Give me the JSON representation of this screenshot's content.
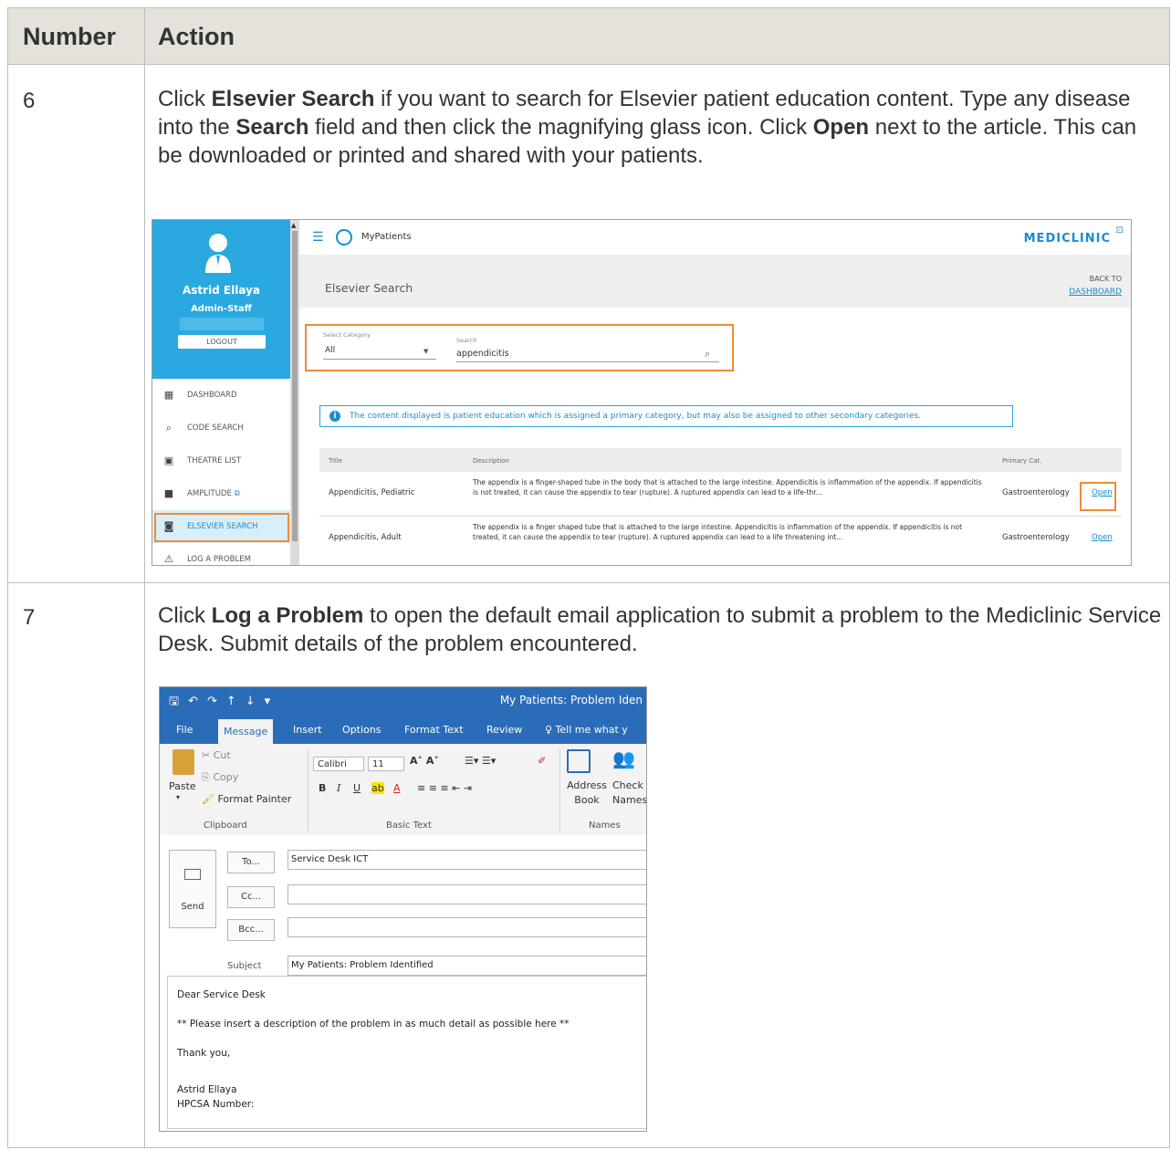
{
  "table": {
    "headers": [
      "Number",
      "Action"
    ],
    "rows": [
      {
        "number": "6",
        "text_parts": [
          "Click ",
          "Elsevier Search",
          " if you want to search for Elsevier patient education content. Type any disease into the ",
          "Search",
          " field and then click the magnifying glass icon. Click ",
          "Open",
          " next to the article. This can be downloaded or printed and shared with your patients."
        ]
      },
      {
        "number": "7",
        "text_parts": [
          "Click ",
          "Log a Problem",
          " to open the default email application to submit a problem to the Mediclinic Service Desk. Submit details of the problem encountered."
        ]
      }
    ]
  },
  "screenshot1": {
    "user_name": "Astrid Ellaya",
    "user_role": "Admin-Staff",
    "logout": "LOGOUT",
    "nav": [
      {
        "label": "DASHBOARD",
        "icon": "dashboard-icon",
        "glyph": "▦"
      },
      {
        "label": "CODE SEARCH",
        "icon": "search-icon",
        "glyph": "⌕"
      },
      {
        "label": "THEATRE LIST",
        "icon": "calendar-icon",
        "glyph": "▣"
      },
      {
        "label": "AMPLITUDE",
        "icon": "briefcase-icon",
        "glyph": "■",
        "suffix": "⧉"
      },
      {
        "label": "ELSEVIER SEARCH",
        "icon": "elsevier-search-icon",
        "glyph": "◙"
      },
      {
        "label": "LOG A PROBLEM",
        "icon": "warning-icon",
        "glyph": "⚠"
      }
    ],
    "app_title": "MyPatients",
    "brand": "MEDICLINIC",
    "page_title": "Elsevier Search",
    "back_to": "BACK TO",
    "dashboard_link": "DASHBOARD",
    "category_label": "Select Category",
    "category_value": "All",
    "search_label": "Search",
    "search_value": "appendicitis",
    "info_text": "The content displayed is patient education which is assigned a primary category, but may also be assigned to other secondary categories.",
    "columns": [
      "Title",
      "Description",
      "Primary Cat."
    ],
    "results": [
      {
        "title": "Appendicitis, Pediatric",
        "description": "The appendix is a finger-shaped tube in the body that is attached to the large intestine. Appendicitis is inflammation of the appendix. If appendicitis is not treated, it can cause the appendix to tear (rupture). A ruptured appendix can lead to a life-thr...",
        "category": "Gastroenterology",
        "action": "Open"
      },
      {
        "title": "Appendicitis, Adult",
        "description": "The appendix is a finger shaped tube that is attached to the large intestine. Appendicitis is inflammation of the appendix. If appendicitis is not treated, it can cause the appendix to tear (rupture). A ruptured appendix can lead to a life threatening int...",
        "category": "Gastroenterology",
        "action": "Open"
      }
    ]
  },
  "screenshot2": {
    "window_title": "My Patients: Problem Iden",
    "tabs": [
      "File",
      "Message",
      "Insert",
      "Options",
      "Format Text",
      "Review",
      "♀ Tell me what y"
    ],
    "clipboard": {
      "cut": "Cut",
      "copy": "Copy",
      "paste": "Paste",
      "format_painter": "Format Painter",
      "group": "Clipboard"
    },
    "basic_text": {
      "font": "Calibri",
      "size": "11",
      "group": "Basic Text"
    },
    "names": {
      "address_book": "Address Book",
      "check_names": "Check Names",
      "group": "Names"
    },
    "send": "Send",
    "to_button": "To...",
    "cc_button": "Cc...",
    "bcc_button": "Bcc...",
    "to_value": "Service Desk ICT",
    "subject_label": "Subject",
    "subject_value": "My Patients: Problem Identified",
    "body_lines": [
      "Dear Service Desk",
      "** Please insert a description of the problem in as much detail as possible here **",
      "Thank you,",
      "Astrid Ellaya",
      "HPCSA Number:"
    ],
    "colors": {
      "ribbon_blue": "#2b6cb8",
      "mediclinic_blue": "#1b8ccf",
      "highlight_orange": "#f08b36"
    }
  }
}
